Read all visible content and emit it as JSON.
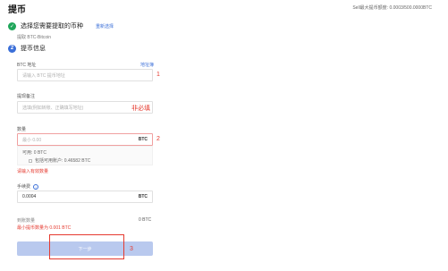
{
  "page": {
    "title": "提币",
    "top_right": "Sell最大提币额度: 0.0003/500.0000BTC"
  },
  "step1": {
    "title": "选择您需要提取的币种",
    "link": "重新选择",
    "sub": "提取 BTC-Bitcoin"
  },
  "step2": {
    "number": "2",
    "title": "提币信息"
  },
  "address": {
    "label": "BTC 地址",
    "link": "地址簿",
    "placeholder": "请输入 BTC 提币地址",
    "annotation": "1"
  },
  "memo": {
    "label": "提现备注",
    "placeholder": "选填(例如转账、正确填写地址)",
    "annotation": "非必填"
  },
  "amount": {
    "label": "数量",
    "placeholder": "最小 0.00",
    "unit": "BTC",
    "annotation": "2",
    "available": "可用: 0 BTC",
    "frozen": "包括可用账户: 0.46582 BTC",
    "error": "请输入有效数量"
  },
  "fee": {
    "label": "手续费",
    "value": "0.0004",
    "unit": "BTC"
  },
  "arrive": {
    "label": "到账数量",
    "value": "0 BTC",
    "min_note": "最小提币数量为 0.001 BTC"
  },
  "submit": {
    "label": "下一步",
    "annotation": "3"
  }
}
